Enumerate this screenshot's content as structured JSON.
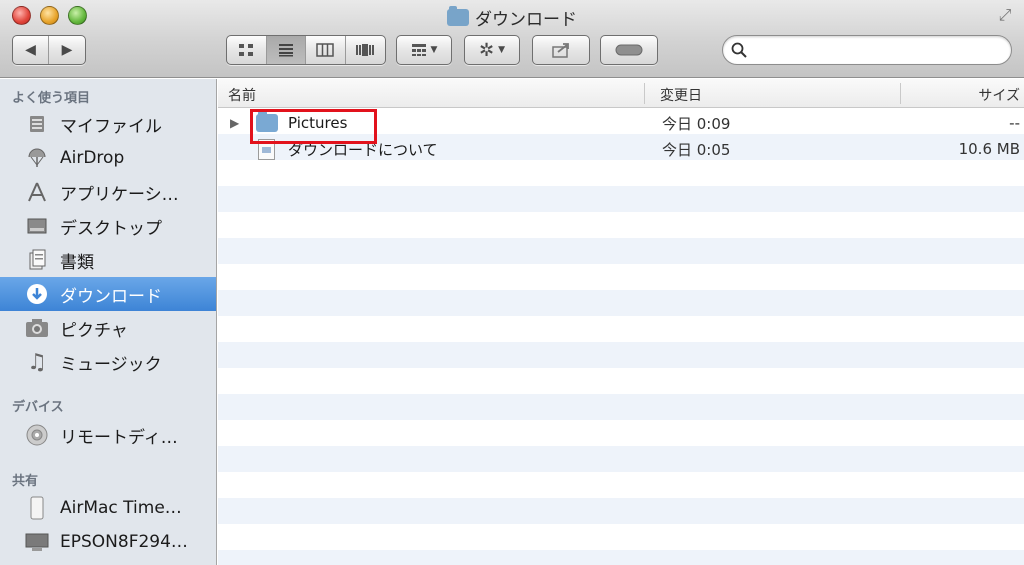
{
  "window": {
    "title": "ダウンロード",
    "icons": {
      "title": "folder-icon",
      "fullscreen": "fullscreen-icon"
    }
  },
  "toolbar": {
    "nav": {
      "back": "◀",
      "forward": "▶"
    },
    "view_modes": [
      "icon-view",
      "list-view",
      "column-view",
      "coverflow-view"
    ],
    "active_view": "list-view",
    "arrange_icon": "arrange-icon",
    "action_icon": "gear-icon",
    "share_icon": "share-icon",
    "tag_icon": "tag-icon",
    "search": {
      "value": "",
      "placeholder": ""
    }
  },
  "sidebar": {
    "sections": [
      {
        "heading": "よく使う項目",
        "items": [
          {
            "label": "マイファイル",
            "icon": "all-my-files-icon"
          },
          {
            "label": "AirDrop",
            "icon": "airdrop-icon"
          },
          {
            "label": "アプリケーシ…",
            "icon": "applications-icon"
          },
          {
            "label": "デスクトップ",
            "icon": "desktop-icon"
          },
          {
            "label": "書類",
            "icon": "documents-icon"
          },
          {
            "label": "ダウンロード",
            "icon": "downloads-icon",
            "selected": true
          },
          {
            "label": "ピクチャ",
            "icon": "pictures-icon"
          },
          {
            "label": "ミュージック",
            "icon": "music-icon"
          }
        ]
      },
      {
        "heading": "デバイス",
        "items": [
          {
            "label": "リモートディ…",
            "icon": "remote-disc-icon"
          }
        ]
      },
      {
        "heading": "共有",
        "items": [
          {
            "label": "AirMac Time…",
            "icon": "airport-time-capsule-icon"
          },
          {
            "label": "EPSON8F294…",
            "icon": "network-computer-icon"
          }
        ]
      }
    ]
  },
  "list": {
    "columns": {
      "name": "名前",
      "date": "変更日",
      "size": "サイズ"
    },
    "rows": [
      {
        "name": "Pictures",
        "date": "今日 0:09",
        "size": "--",
        "kind": "folder"
      },
      {
        "name": "ダウンロードについて",
        "date": "今日 0:05",
        "size": "10.6 MB",
        "kind": "document"
      }
    ]
  },
  "colors": {
    "selection": "#3d84d6",
    "sidebar_bg": "#e1e6ec",
    "row_stripe": "#eef3fa",
    "highlight_box": "#e2121c"
  }
}
